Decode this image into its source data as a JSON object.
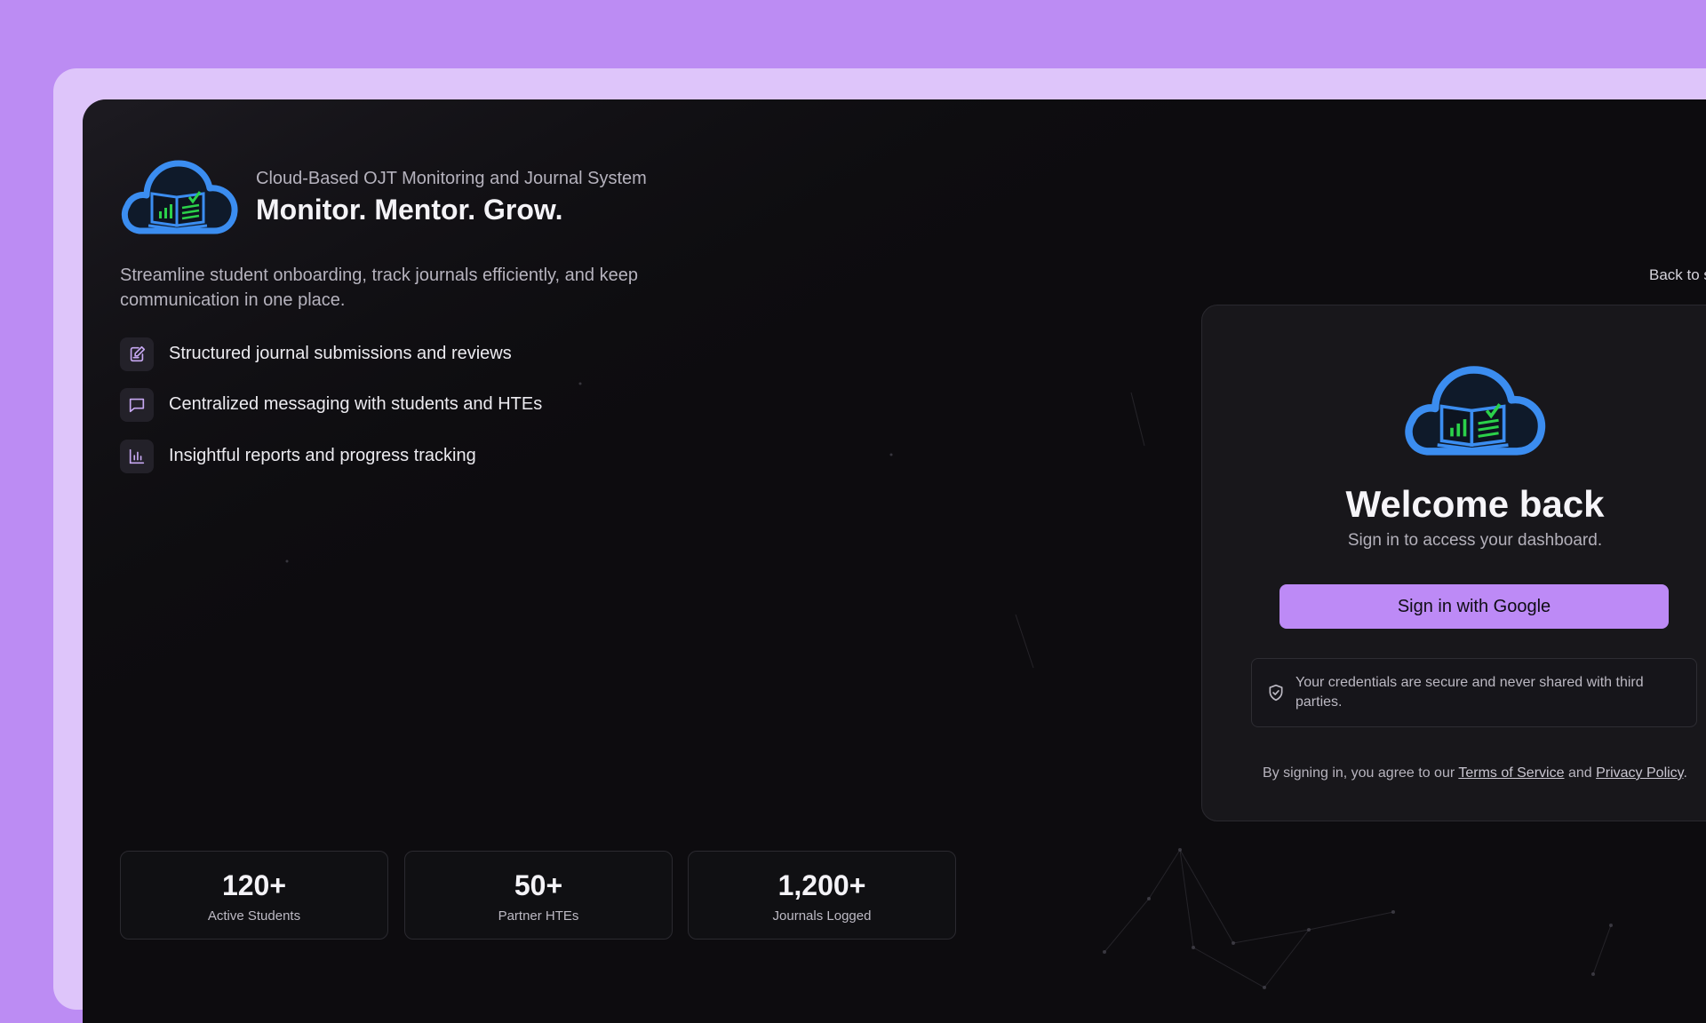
{
  "brand": {
    "subtitle": "Cloud-Based OJT Monitoring and Journal System",
    "title": "Monitor. Mentor. Grow.",
    "description": "Streamline student onboarding, track journals efficiently, and keep communication in one place."
  },
  "features": [
    {
      "icon": "edit-note-icon",
      "label": "Structured journal submissions and reviews"
    },
    {
      "icon": "chat-bubble-icon",
      "label": "Centralized messaging with students and HTEs"
    },
    {
      "icon": "bar-chart-icon",
      "label": "Insightful reports and progress tracking"
    }
  ],
  "stats": [
    {
      "value": "120+",
      "label": "Active Students"
    },
    {
      "value": "50+",
      "label": "Partner HTEs"
    },
    {
      "value": "1,200+",
      "label": "Journals Logged"
    }
  ],
  "nav": {
    "back_label": "Back to s"
  },
  "login": {
    "heading": "Welcome back",
    "subheading": "Sign in to access your dashboard.",
    "google_button": "Sign in with Google",
    "secure_note": "Your credentials are secure and never shared with third parties.",
    "terms_prefix": "By signing in, you agree to our",
    "terms_link": "Terms of Service",
    "terms_and": "and",
    "privacy_link": "Privacy Policy",
    "terms_suffix": "."
  },
  "colors": {
    "page_background": "#bc8cf3",
    "frame": "#dec5fa",
    "screen_background": "#0d0c0f",
    "accent_button": "#bd8af6",
    "logo_blue": "#3b8df0",
    "logo_green": "#2bd14a"
  }
}
